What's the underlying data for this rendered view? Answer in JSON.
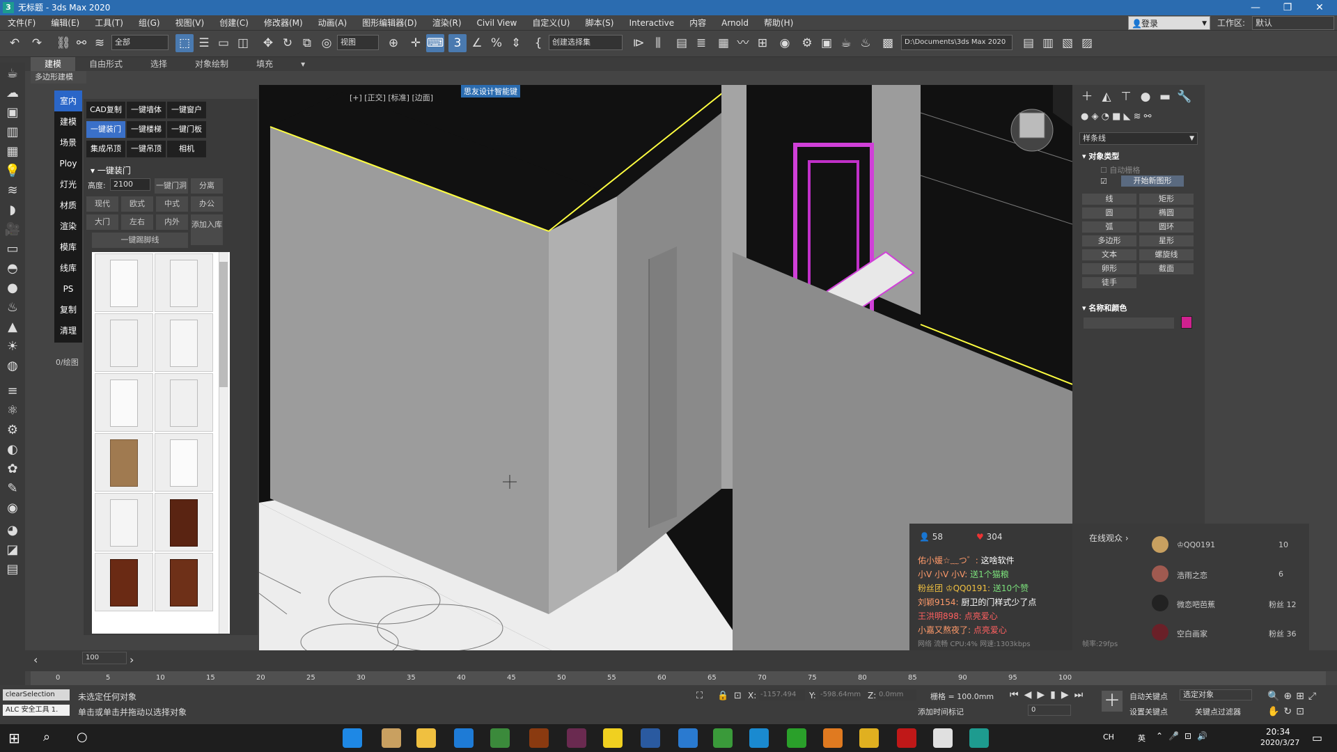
{
  "window": {
    "title": "无标题 - 3ds Max 2020"
  },
  "menu": [
    "文件(F)",
    "编辑(E)",
    "工具(T)",
    "组(G)",
    "视图(V)",
    "创建(C)",
    "修改器(M)",
    "动画(A)",
    "图形编辑器(D)",
    "渲染(R)",
    "Civil View",
    "自定义(U)",
    "脚本(S)",
    "Interactive",
    "内容",
    "Arnold",
    "帮助(H)"
  ],
  "account": {
    "login": "登录",
    "workspace_label": "工作区:",
    "workspace_value": "默认"
  },
  "toolbar": {
    "filter": "全部",
    "view": "视图",
    "selection_set": "创建选择集",
    "project_path": "D:\\Documents\\3ds Max 2020"
  },
  "ribbon": {
    "tabs": [
      "建模",
      "自由形式",
      "选择",
      "对象绘制",
      "填充"
    ],
    "sub": "多边形建模"
  },
  "plugin": {
    "nav": [
      "室内",
      "建模",
      "场景",
      "Ploy",
      "灯光",
      "材质",
      "渲染",
      "模库",
      "线库",
      "PS",
      "复制",
      "清理"
    ],
    "buttons": [
      "CAD复制",
      "一键墙体",
      "一键窗户",
      "一键装门",
      "一键楼梯",
      "一键门板",
      "集成吊顶",
      "一键吊顶",
      "相机"
    ],
    "section": "一键装门",
    "height_label": "高度:",
    "height_value": "2100",
    "btn_door_hole": "一键门洞",
    "btn_separate": "分离",
    "styles": [
      "现代",
      "欧式",
      "中式",
      "办公"
    ],
    "door_types": [
      "大门",
      "左右",
      "内外"
    ],
    "add_lib": "添加入库",
    "skirting": "一键踢脚线",
    "side_label": "0/绘图"
  },
  "viewport": {
    "label": "[+] [正交] [标准] [边面]",
    "title": "思友设计智能键"
  },
  "cmdpanel": {
    "dropdown": "样条线",
    "rollout_type": "对象类型",
    "autogrid": "自动栅格",
    "start_new": "开始新图形",
    "shapes": [
      "线",
      "矩形",
      "圆",
      "椭圆",
      "弧",
      "圆环",
      "多边形",
      "星形",
      "文本",
      "螺旋线",
      "卵形",
      "截面",
      "徒手"
    ],
    "rollout_name": "名称和颜色",
    "color": "#d0218f"
  },
  "stream": {
    "viewers": "58",
    "likes": "304",
    "chat": [
      {
        "user": "佑小媛☆﹏つ゛:",
        "msg": "这啥软件",
        "ucolor": "#ff9a6a",
        "mcolor": "#ffffff"
      },
      {
        "user": "小V 小V 小V:",
        "msg": "送1个猫粮",
        "ucolor": "#ff9a6a",
        "mcolor": "#7be07b"
      },
      {
        "user": "粉丝团 ♔QQ0191:",
        "msg": "送10个赞",
        "ucolor": "#f0c040",
        "mcolor": "#7be07b"
      },
      {
        "user": "刘颖9154:",
        "msg": "厨卫的门样式少了点",
        "ucolor": "#ff9a6a",
        "mcolor": "#ffffff"
      },
      {
        "user": "王洪明898:",
        "msg": "点亮爱心",
        "ucolor": "#ff6060",
        "mcolor": "#ff6060"
      },
      {
        "user": "小嘉又熬夜了:",
        "msg": "点亮爱心",
        "ucolor": "#ff9a6a",
        "mcolor": "#ff6060"
      }
    ],
    "footer": "网络 流畅   CPU:4%   网速:1303kbps",
    "fps": "帧率:29fps",
    "audience_title": "在线观众 ›",
    "audience": [
      {
        "name": "♔QQ0191",
        "value": "10"
      },
      {
        "name": "浩雨之恋",
        "value": "6"
      },
      {
        "name": "微恋吧芭蕉",
        "value": "粉丝 12"
      },
      {
        "name": "空白画家",
        "value": "粉丝 36"
      }
    ]
  },
  "timeline": {
    "frame": "100",
    "pos": "0 / 100",
    "ticks": [
      "0",
      "5",
      "10",
      "15",
      "20",
      "25",
      "30",
      "35",
      "40",
      "45",
      "50",
      "55",
      "60",
      "65",
      "70",
      "75",
      "80",
      "85",
      "90",
      "95",
      "100"
    ]
  },
  "status": {
    "script1": "clearSelection",
    "script2": "ALC 安全工具 1.",
    "msg1": "未选定任何对象",
    "msg2": "单击或单击并拖动以选择对象",
    "x_label": "X:",
    "x_value": "-1157.494",
    "y_label": "Y:",
    "y_value": "-598.64mm",
    "z_label": "Z:",
    "z_value": "0.0mm",
    "grid": "栅格 = 100.0mm",
    "add_tag": "添加时间标记",
    "autokey": "自动关键点",
    "setkey": "设置关键点",
    "selected": "选定对象",
    "keyfilter": "关键点过滤器",
    "frame_value": "0"
  },
  "taskbar": {
    "lang": "CH",
    "ime": "英",
    "time": "20:34",
    "date": "2020/3/27"
  }
}
